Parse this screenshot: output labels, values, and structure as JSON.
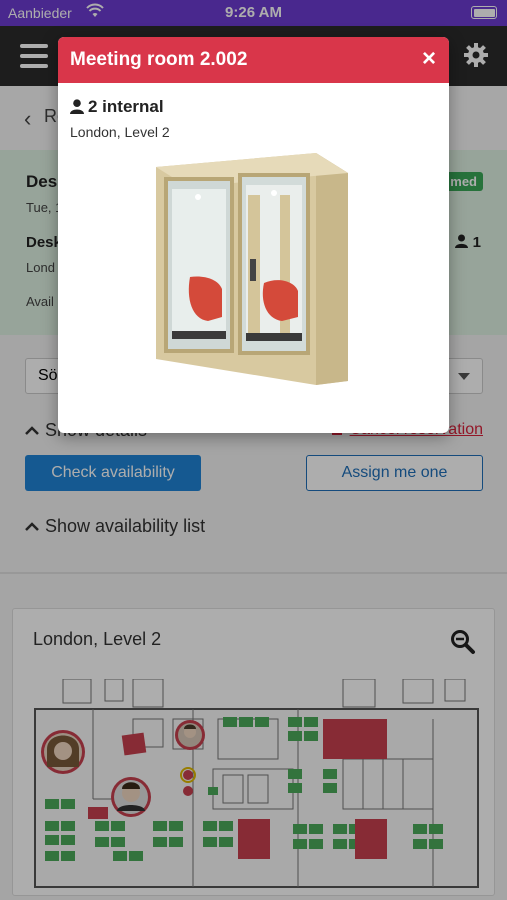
{
  "status_bar": {
    "carrier": "Aanbieder",
    "time": "9:26 AM"
  },
  "back": {
    "label": "Re"
  },
  "booking": {
    "title": "Des",
    "date": "Tue, 1",
    "badge": "med",
    "desk": "Desk",
    "location": "Lond",
    "count": "1",
    "availability": "Avail"
  },
  "search": {
    "value": "Sö"
  },
  "show_details": "Show details",
  "cancel_reservation": "Cancel reservation",
  "buttons": {
    "check": "Check availability",
    "assign": "Assign me one"
  },
  "show_availability_list": "Show availability list",
  "map": {
    "title": "London, Level 2"
  },
  "modal": {
    "title": "Meeting room 2.002",
    "capacity": "2 internal",
    "location": "London, Level 2"
  },
  "colors": {
    "accent": "#d9364a",
    "primary": "#1f84d6",
    "status_bar": "#6c3bd1",
    "success": "#3aa858"
  },
  "icons": [
    "hamburger-icon",
    "gear-icon",
    "chevron-left-icon",
    "user-icon",
    "chevron-up-icon",
    "trash-icon",
    "zoom-out-icon",
    "close-icon",
    "wifi-icon",
    "battery-icon"
  ]
}
